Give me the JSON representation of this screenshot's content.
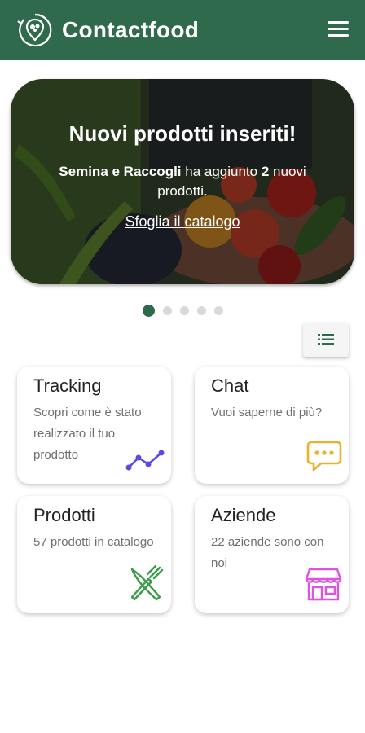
{
  "header": {
    "brand": "Contactfood",
    "brand_color": "#2e6a4b"
  },
  "banner": {
    "title": "Nuovi prodotti inseriti!",
    "company": "Semina e Raccogli",
    "text_before_count": " ha aggiunto ",
    "count": "2",
    "text_after_count": " nuovi prodotti.",
    "link": "Sfoglia il catalogo"
  },
  "carousel": {
    "total_slides": 5,
    "active_index": 0
  },
  "cards": {
    "tracking": {
      "title": "Tracking",
      "subtitle": "Scopri come è stato realizzato il tuo prodotto",
      "icon": "trend-line-icon",
      "icon_color": "#5b49e6"
    },
    "chat": {
      "title": "Chat",
      "subtitle": "Vuoi saperne di più?",
      "icon": "chat-bubble-icon",
      "icon_color": "#e8b230"
    },
    "prodotti": {
      "title": "Prodotti",
      "subtitle": "57 prodotti in catalogo",
      "icon": "fork-knife-icon",
      "icon_color": "#3a9b48"
    },
    "aziende": {
      "title": "Aziende",
      "subtitle": "22 aziende sono con noi",
      "icon": "storefront-icon",
      "icon_color": "#e052e0"
    }
  }
}
